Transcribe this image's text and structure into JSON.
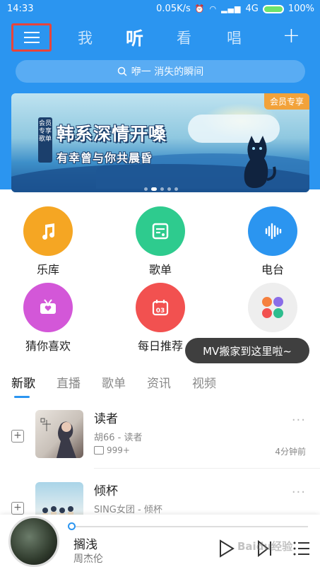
{
  "status_bar": {
    "time": "14:33",
    "speed": "0.05K/s",
    "network": "4G",
    "battery": "100%"
  },
  "header": {
    "tabs": [
      {
        "label": "我"
      },
      {
        "label": "听"
      },
      {
        "label": "看"
      },
      {
        "label": "唱"
      }
    ],
    "active_tab": "听",
    "search_placeholder": "咿一 消失的瞬间"
  },
  "banner": {
    "badge": "会员专享",
    "side_tag": "会员专享歌单",
    "title": "韩系深情开嗓",
    "subtitle": "有幸曾与你共晨昏",
    "pages": 5,
    "active_page": 1
  },
  "categories": [
    {
      "label": "乐库",
      "color": "#f5a623",
      "icon": "music-note-icon"
    },
    {
      "label": "歌单",
      "color": "#2ecb8e",
      "icon": "playlist-icon"
    },
    {
      "label": "电台",
      "color": "#2b95f0",
      "icon": "radio-wave-icon"
    },
    {
      "label": "猜你喜欢",
      "color": "#d357d8",
      "icon": "radio-heart-icon"
    },
    {
      "label": "每日推荐",
      "color": "#f25150",
      "icon": "calendar-icon",
      "day": "03"
    },
    {
      "label": "更多",
      "color": "#eeeeee",
      "icon": "more-apps-icon"
    }
  ],
  "tooltip": "MV搬家到这里啦~",
  "sub_tabs": [
    {
      "label": "新歌"
    },
    {
      "label": "直播"
    },
    {
      "label": "歌单"
    },
    {
      "label": "资讯"
    },
    {
      "label": "视频"
    }
  ],
  "songs": [
    {
      "title": "读者",
      "artist": "胡66 - 读者",
      "comments": "999+",
      "ago": "4分钟前"
    },
    {
      "title": "倾杯",
      "artist": "SING女团 - 倾杯",
      "comments": "",
      "ago": ""
    }
  ],
  "player": {
    "title": "搁浅",
    "artist": "周杰伦",
    "progress": 0.0
  },
  "watermark": "Baidu经验"
}
